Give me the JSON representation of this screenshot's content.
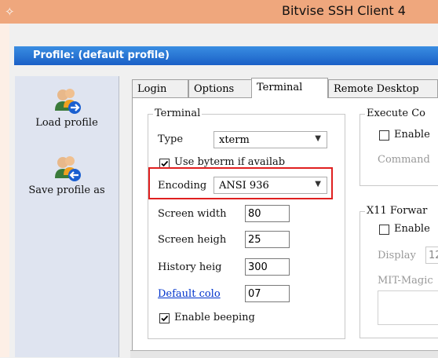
{
  "window": {
    "title": "Bitvise SSH Client 4"
  },
  "profile": {
    "header": "Profile: (default profile)"
  },
  "sidebar": {
    "load_label": "Load profile",
    "save_label": "Save profile as"
  },
  "tabs": [
    {
      "label": "Login"
    },
    {
      "label": "Options"
    },
    {
      "label": "Terminal"
    },
    {
      "label": "Remote Desktop"
    }
  ],
  "terminal": {
    "group_title": "Terminal",
    "type_label": "Type",
    "type_value": "xterm",
    "use_byterm_label": "Use byterm if availab",
    "use_byterm_checked": true,
    "encoding_label": "Encoding",
    "encoding_value": "ANSI 936",
    "screen_width_label": "Screen width",
    "screen_width_value": "80",
    "screen_height_label": "Screen heigh",
    "screen_height_value": "25",
    "history_label": "History heig",
    "history_value": "300",
    "default_color_link": "Default colo",
    "default_color_value": "07",
    "enable_beeping_label": "Enable beeping",
    "enable_beeping_checked": true
  },
  "execute": {
    "group_title": "Execute Co",
    "enable_label": "Enable",
    "command_label": "Command"
  },
  "x11": {
    "group_title": "X11 Forwar",
    "enable_label": "Enable",
    "display_label": "Display",
    "display_value": "12",
    "mit_label": "MIT-Magic"
  },
  "colors": {
    "titlebar": "#efa77d",
    "header": "#1a5fc6",
    "link": "#0033cc",
    "highlight": "#e02020"
  }
}
